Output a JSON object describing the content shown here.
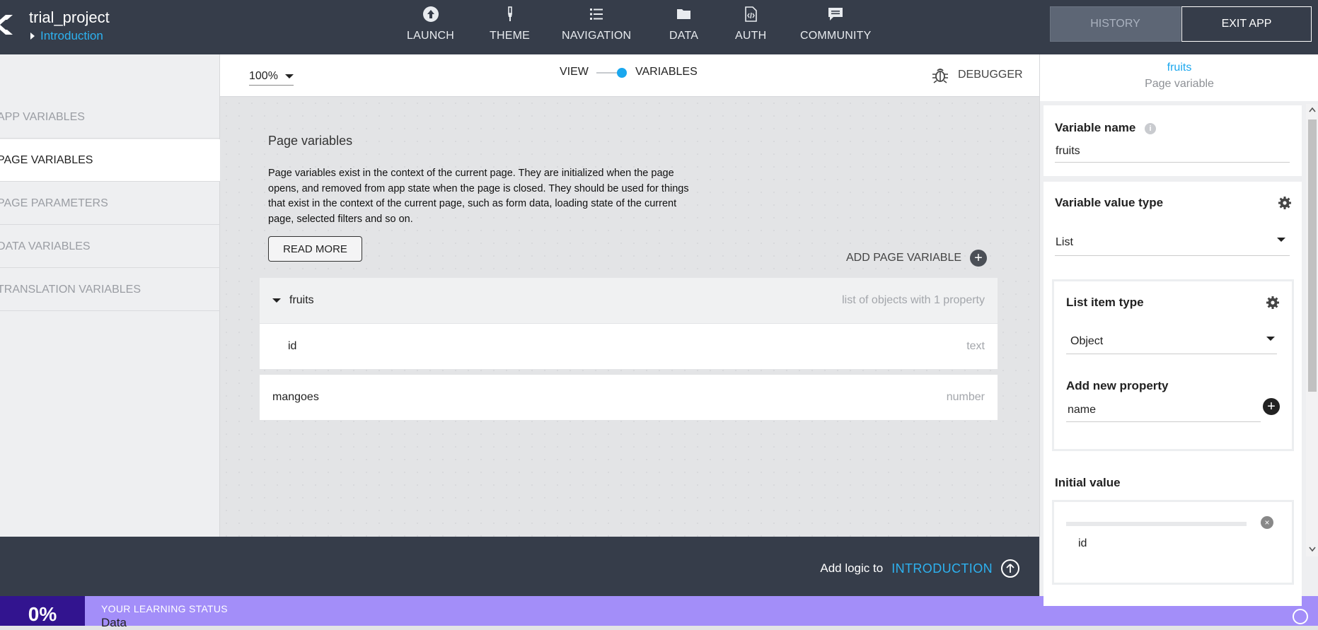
{
  "header": {
    "project_title": "trial_project",
    "breadcrumb": "Introduction",
    "nav": [
      {
        "label": "LAUNCH",
        "icon": "launch-icon"
      },
      {
        "label": "THEME",
        "icon": "brush-icon"
      },
      {
        "label": "NAVIGATION",
        "icon": "list-icon"
      },
      {
        "label": "DATA",
        "icon": "folder-icon"
      },
      {
        "label": "AUTH",
        "icon": "code-file-icon"
      },
      {
        "label": "COMMUNITY",
        "icon": "chat-icon"
      }
    ],
    "history_label": "HISTORY",
    "exit_label": "EXIT APP"
  },
  "sidebar": {
    "items": [
      {
        "label": "APP VARIABLES",
        "active": false
      },
      {
        "label": "PAGE VARIABLES",
        "active": true
      },
      {
        "label": "PAGE PARAMETERS",
        "active": false
      },
      {
        "label": "DATA VARIABLES",
        "active": false
      },
      {
        "label": "TRANSLATION VARIABLES",
        "active": false
      }
    ]
  },
  "toolbar": {
    "zoom": "100%",
    "view_label": "VIEW",
    "variables_label": "VARIABLES",
    "debugger_label": "DEBUGGER"
  },
  "main": {
    "title": "Page variables",
    "description": "Page variables exist in the context of the current page. They are initialized when the page opens, and removed from app state when the page is closed. They should be used for things that exist in the context of the current page, such as form data, loading state of the current page, selected filters and so on.",
    "read_more": "READ MORE",
    "add_variable": "ADD PAGE VARIABLE",
    "variables": [
      {
        "name": "fruits",
        "type": "list of objects with 1 property"
      },
      {
        "name": "id",
        "type": "text"
      },
      {
        "name": "mangoes",
        "type": "number"
      }
    ]
  },
  "logic": {
    "prefix": "Add logic to",
    "page": "INTRODUCTION"
  },
  "learning": {
    "percent": "0%",
    "label": "YOUR LEARNING STATUS",
    "value": "Data"
  },
  "inspector": {
    "name": "fruits",
    "subtitle": "Page variable",
    "variable_name_label": "Variable name",
    "variable_name_value": "fruits",
    "value_type_label": "Variable value type",
    "value_type": "List",
    "list_item_type_label": "List item type",
    "list_item_type": "Object",
    "add_property_label": "Add new property",
    "add_property_value": "name",
    "initial_value_label": "Initial value",
    "initial_value_partial": "id"
  },
  "colors": {
    "topbar": "#363d4a",
    "accent": "#1aa7ee",
    "status_bar": "#a38ef9",
    "status_pct_bg": "#32148f"
  }
}
